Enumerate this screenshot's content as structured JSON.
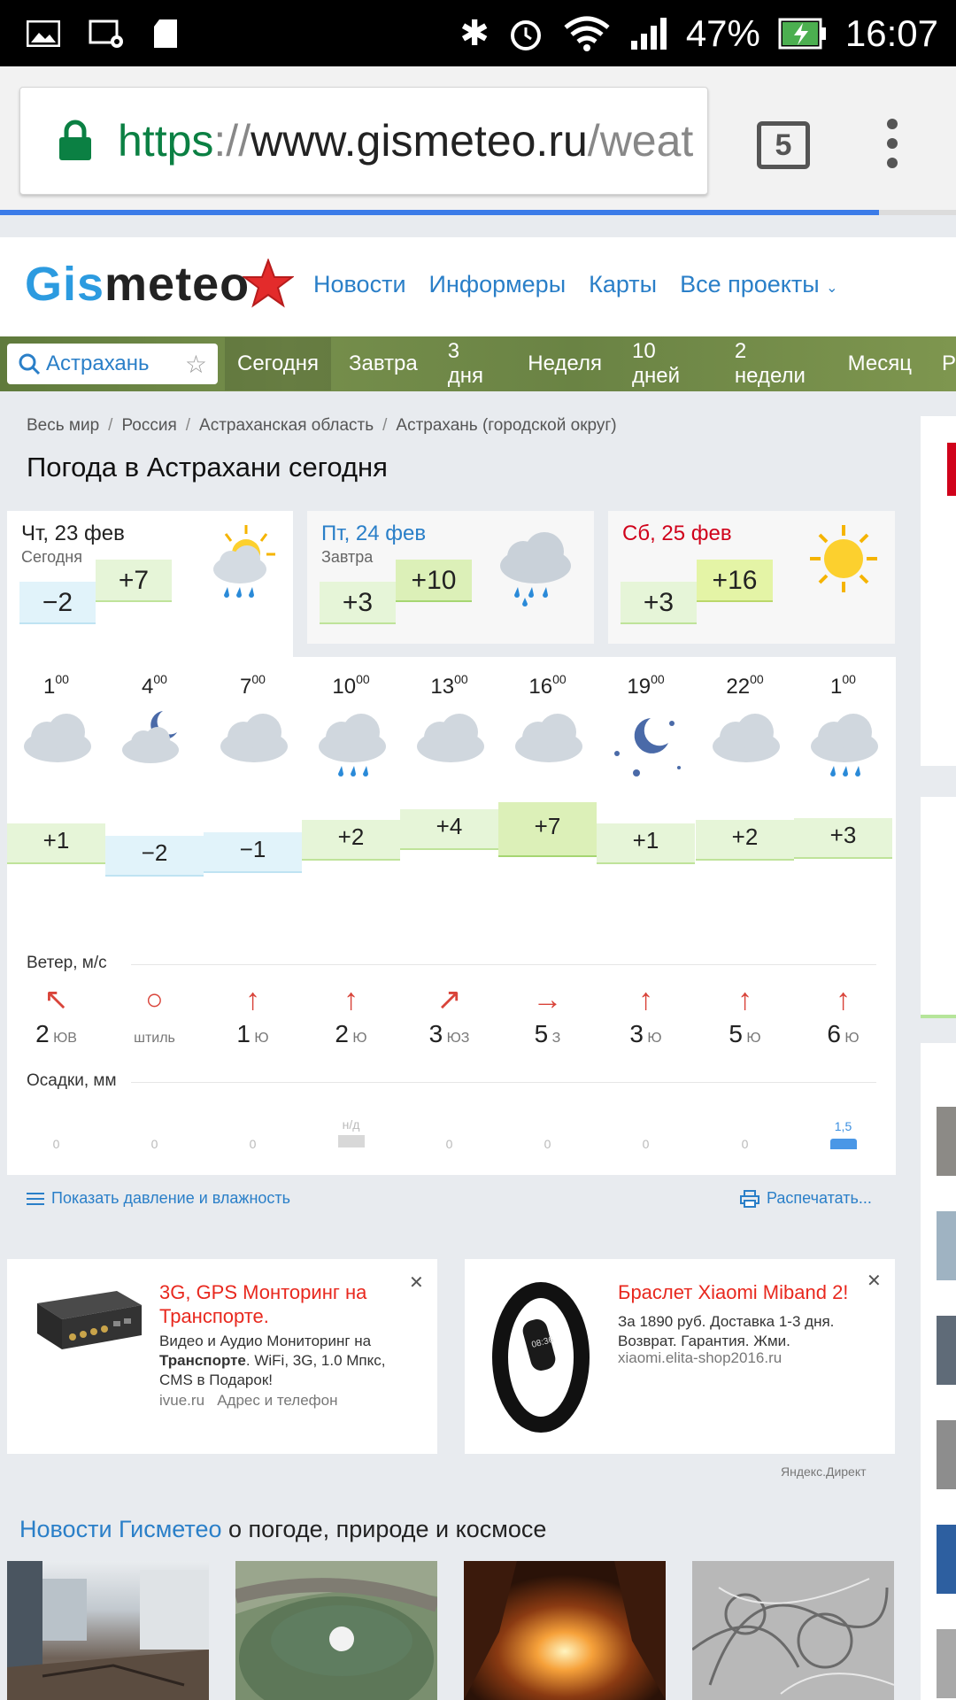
{
  "status_bar": {
    "battery": "47%",
    "time": "16:07"
  },
  "browser": {
    "url_scheme": "https",
    "url_sep": "://",
    "url_host": "www.gismeteo.ru",
    "url_path": "/weat",
    "tab_count": "5"
  },
  "site": {
    "logo_part1": "Gis",
    "logo_part2": "meteo",
    "nav": [
      "Новости",
      "Информеры",
      "Карты",
      "Все проекты"
    ],
    "search_value": "Астрахань",
    "period_tabs": [
      "Сегодня",
      "Завтра",
      "3 дня",
      "Неделя",
      "10 дней",
      "2 недели",
      "Месяц",
      "Р"
    ]
  },
  "breadcrumb": [
    "Весь мир",
    "Россия",
    "Астраханская область",
    "Астрахань (городской округ)"
  ],
  "page_title": "Погода в Астрахани сегодня",
  "days": [
    {
      "date": "Чт, 23 фев",
      "sub": "Сегодня",
      "tmin": "−2",
      "tmax": "+7"
    },
    {
      "date": "Пт, 24 фев",
      "sub": "Завтра",
      "tmin": "+3",
      "tmax": "+10"
    },
    {
      "date": "Сб, 25 фев",
      "sub": "",
      "tmin": "+3",
      "tmax": "+16"
    }
  ],
  "colors": {
    "blue_date": "#2a7fc8",
    "red_date": "#d0021b"
  },
  "hourly": {
    "times": [
      {
        "h": "1",
        "m": "00"
      },
      {
        "h": "4",
        "m": "00"
      },
      {
        "h": "7",
        "m": "00"
      },
      {
        "h": "10",
        "m": "00"
      },
      {
        "h": "13",
        "m": "00"
      },
      {
        "h": "16",
        "m": "00"
      },
      {
        "h": "19",
        "m": "00"
      },
      {
        "h": "22",
        "m": "00"
      },
      {
        "h": "1",
        "m": "00"
      }
    ],
    "icons": [
      "cloud-icon",
      "night-cloud-icon",
      "cloud-icon",
      "cloud-rain-icon",
      "cloud-icon",
      "cloud-icon",
      "night-clear-icon",
      "cloud-icon",
      "cloud-rain-icon"
    ],
    "temps": [
      "+1",
      "−2",
      "−1",
      "+2",
      "+4",
      "+7",
      "+1",
      "+2",
      "+3"
    ],
    "wind_label": "Ветер, м/с",
    "wind": [
      {
        "speed": "2",
        "dir": "ЮВ",
        "arrow": "↖"
      },
      {
        "speed": "",
        "dir": "штиль",
        "arrow": "○"
      },
      {
        "speed": "1",
        "dir": "Ю",
        "arrow": "↑"
      },
      {
        "speed": "2",
        "dir": "Ю",
        "arrow": "↑"
      },
      {
        "speed": "3",
        "dir": "ЮЗ",
        "arrow": "↗"
      },
      {
        "speed": "5",
        "dir": "З",
        "arrow": "→"
      },
      {
        "speed": "3",
        "dir": "Ю",
        "arrow": "↑"
      },
      {
        "speed": "5",
        "dir": "Ю",
        "arrow": "↑"
      },
      {
        "speed": "6",
        "dir": "Ю",
        "arrow": "↑"
      }
    ],
    "precip_label": "Осадки, мм",
    "precip": [
      "0",
      "0",
      "0",
      "н/д",
      "0",
      "0",
      "0",
      "0",
      "1,5"
    ]
  },
  "links": {
    "show_pressure": "Показать давление и влажность",
    "print": "Распечатать..."
  },
  "ads": [
    {
      "title": "3G, GPS Монторинг на Транспорте.",
      "text_line1": "Видео и Аудио Мониторинг на",
      "text_line2_bold": "Транспорте",
      "text_line2_rest": ". WiFi, 3G, 1.0 Мпкс,",
      "text_line3": "CMS в Подарок!",
      "url": "ivue.ru",
      "extra": "Адрес и телефон"
    },
    {
      "title": "Браслет Xiaomi Miband 2!",
      "text_line1": "За 1890 руб. Доставка 1-3 дня.",
      "text_line2": "Возврат. Гарантия. Жми.",
      "url": "xiaomi.elita-shop2016.ru"
    }
  ],
  "yandex_direct": "Яндекс.Директ",
  "news": {
    "title_link": "Новости Гисметео",
    "title_rest": " о погоде, природе и космосе"
  }
}
